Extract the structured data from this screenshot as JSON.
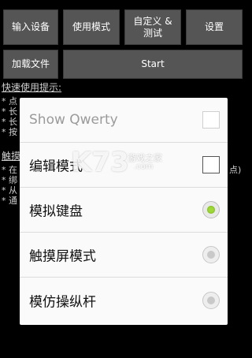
{
  "toolbar": {
    "input_device": "输入设备",
    "usage_mode": "使用模式",
    "custom_test": "自定义 &\n测试",
    "settings": "设置",
    "load_file": "加载文件",
    "start": "Start"
  },
  "help": {
    "title": "快速使用提示:",
    "lines_a": [
      "* 点",
      "* 长",
      "* 长",
      "* 按"
    ],
    "title2": "触摸",
    "lines_b": [
      "* 在",
      "* 绑",
      "* 从",
      "* 通"
    ],
    "right_fragment": "点)"
  },
  "dialog": {
    "items": [
      {
        "label": "Show Qwerty",
        "control": "checkbox",
        "checked": false,
        "enabled": false
      },
      {
        "label": "编辑模式",
        "control": "checkbox",
        "checked": false,
        "enabled": true
      },
      {
        "label": "模拟键盘",
        "control": "radio",
        "selected": true
      },
      {
        "label": "触摸屏模式",
        "control": "radio",
        "selected": false
      },
      {
        "label": "模仿操纵杆",
        "control": "radio",
        "selected": false
      }
    ]
  },
  "watermark": {
    "brand": "K73",
    "text": "游戏之家",
    "domain": ".com"
  },
  "colors": {
    "button_bg": "#555555",
    "dialog_bg": "#fafafa",
    "radio_selected": "#9fd83a"
  }
}
